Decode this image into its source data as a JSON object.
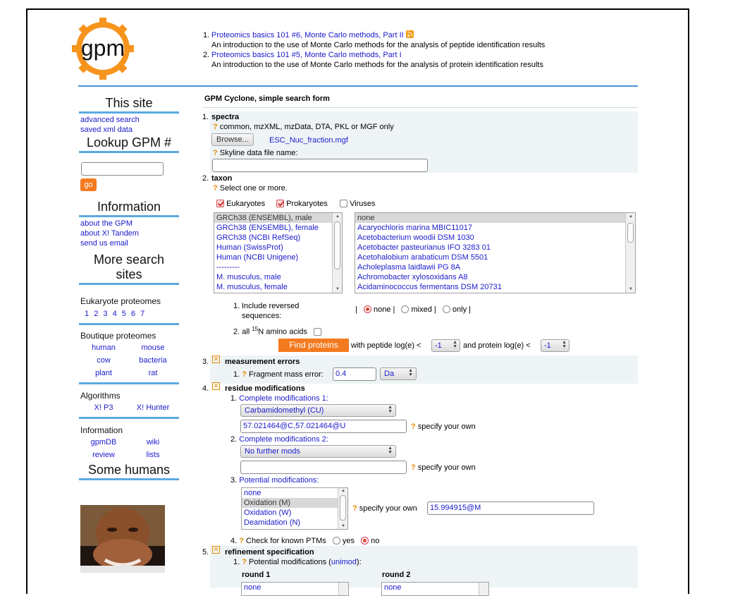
{
  "news": [
    {
      "num": "1.",
      "title": "Proteomics basics 101 #6, Monte Carlo methods, Part II",
      "desc": "An introduction to the use of Monte Carlo methods for the analysis of peptide identification results"
    },
    {
      "num": "2.",
      "title": "Proteomics basics 101 #5, Monte Carlo methods, Part I",
      "desc": "An introduction to the use of Monte Carlo methods for the analysis of protein identification results"
    }
  ],
  "logo_text": "gpm",
  "sidebar": {
    "this_site": "This site",
    "advanced_search": "advanced search",
    "saved_xml": "saved xml data",
    "lookup": "Lookup GPM #",
    "go": "go",
    "information": "Information",
    "about_gpm": "about the GPM",
    "about_xtandem": "about X! Tandem",
    "send_email": "send us email",
    "more_search": "More search sites",
    "euk_label": "Eukaryote proteomes",
    "euk_links": [
      "1",
      "2",
      "3",
      "4",
      "5",
      "6",
      "7"
    ],
    "boutique_label": "Boutique proteomes",
    "boutique_links": [
      "human",
      "mouse",
      "cow",
      "bacteria",
      "plant",
      "rat"
    ],
    "algorithms_label": "Algorithms",
    "algorithms_links": [
      "X! P3",
      "X! Hunter"
    ],
    "info2_label": "Information",
    "info2_links": [
      "gpmDB",
      "wiki",
      "review",
      "lists"
    ],
    "some_humans": "Some humans"
  },
  "form": {
    "title": "GPM Cyclone, simple search form",
    "s1_num": "1.",
    "s1_title": "spectra",
    "s1_hint": "common, mzXML, mzData, DTA, PKL or MGF only",
    "browse": "Browse...",
    "file_name": "ESC_Nuc_fraction.mgf",
    "skyline_label": "Skyline data file name:",
    "s2_num": "2.",
    "s2_title": "taxon",
    "s2_hint": "Select one or more.",
    "eukaryotes": "Eukaryotes",
    "prokaryotes": "Prokaryotes",
    "viruses": "Viruses",
    "euk_list": [
      "GRCh38 (ENSEMBL), male",
      "GRCh38 (ENSEMBL), female",
      "GRCh38 (NCBI RefSeq)",
      "Human (SwissProt)",
      "Human (NCBI Unigene)",
      "---------",
      "M. musculus, male",
      "M. musculus, female"
    ],
    "pro_list": [
      "none",
      "Acaryochloris marina MBIC11017",
      "Acetobacterium woodii DSM 1030",
      "Acetobacter pasteurianus IFO 3283 01",
      "Acetohalobium arabaticum DSM 5501",
      "Acholeplasma laidlawii PG 8A",
      "Achromobacter xylosoxidans A8",
      "Acidaminococcus fermentans DSM 20731"
    ],
    "opt1_num": "1.",
    "opt1_label": "Include reversed sequences:",
    "rev_none": "none |",
    "rev_mixed": "mixed |",
    "rev_only": "only |",
    "bar": "|",
    "opt2_num": "2.",
    "opt2_label_a": "all ",
    "opt2_sup": "15",
    "opt2_label_b": "N amino acids",
    "find": "Find proteins",
    "with_pep": "with peptide log(e) <",
    "pep_val": "-1",
    "and_prot": "and protein log(e) <",
    "prot_val": "-1",
    "s3_num": "3.",
    "s3_title": "measurement errors",
    "frag_num": "1.",
    "frag_label": "Fragment mass error:",
    "frag_val": "0.4",
    "frag_unit": "Da",
    "s4_num": "4.",
    "s4_title": "residue modifications",
    "cm1_num": "1.",
    "cm1_label": "Complete modifications 1:",
    "cm1_sel": "Carbamidomethyl (CU)",
    "cm1_val": "57.021464@C,57.021464@U",
    "specify": "specify your own",
    "cm2_num": "2.",
    "cm2_label": "Complete modifications 2:",
    "cm2_sel": "No further mods",
    "cm2_val": "",
    "pm_num": "3.",
    "pm_label": "Potential modifications:",
    "pm_list": [
      "none",
      "Oxidation (M)",
      "Oxidation (W)",
      "Deamidation (N)"
    ],
    "pm_val": "15.994915@M",
    "ptm_num": "4.",
    "ptm_label": "Check for known PTMs",
    "yes": "yes",
    "no": "no",
    "s5_num": "5.",
    "s5_title": "refinement specification",
    "ref_num": "1.",
    "ref_label_a": "Potential modifications (",
    "ref_link": "unimod",
    "ref_label_b": "):",
    "round1": "round 1",
    "round2": "round 2",
    "round1_first": "none",
    "round2_first": "none",
    "q": "?"
  }
}
